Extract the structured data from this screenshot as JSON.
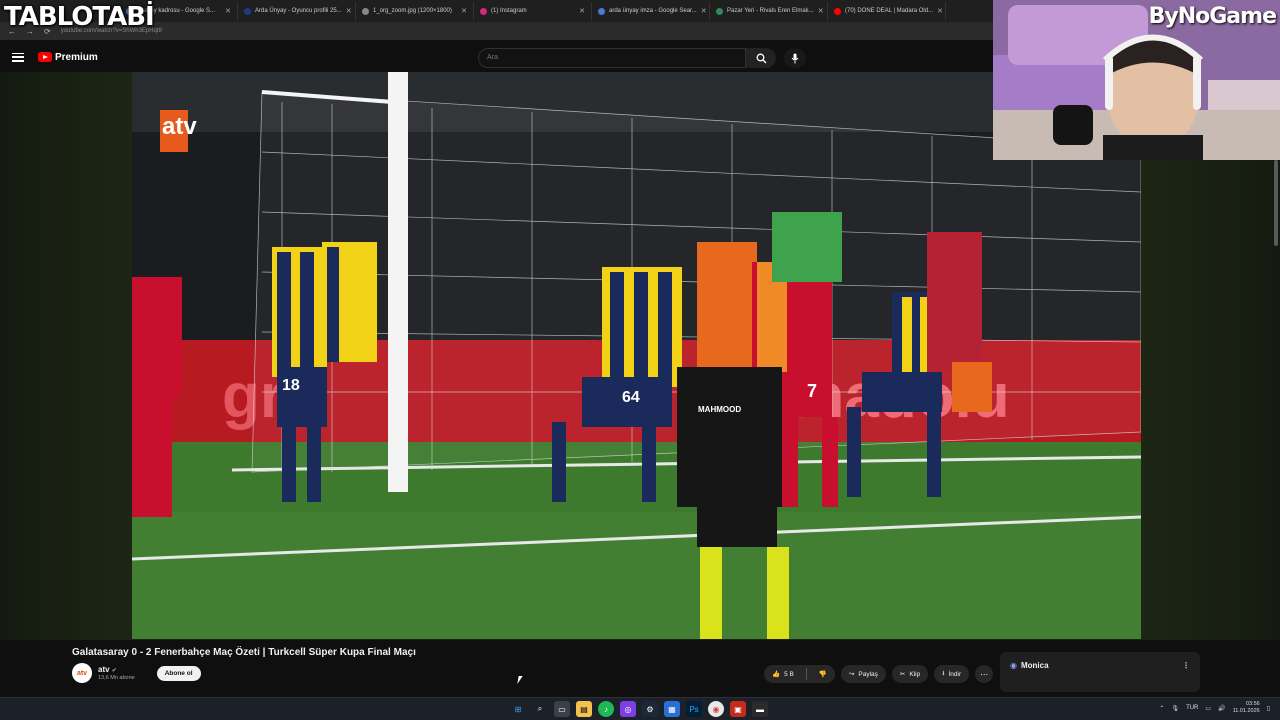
{
  "overlay": {
    "brand_left": "TABLOTABİ",
    "brand_right": "ByNoGame"
  },
  "browser": {
    "tabs": [
      {
        "label": "...saray kadrosu - Google S...",
        "icon": "google-icon"
      },
      {
        "label": "Arda Ünyay - Oyuncu profili 25...",
        "icon": "transfermarkt-icon"
      },
      {
        "label": "1_org_zoom.jpg (1200×1800)",
        "icon": "image-icon"
      },
      {
        "label": "(1) Instagram",
        "icon": "instagram-icon"
      },
      {
        "label": "arda ünyay imza - Google Sear...",
        "icon": "google-icon"
      },
      {
        "label": "Pazar Yeri - Rivals Eren Elmalı...",
        "icon": "rivals-icon"
      },
      {
        "label": "(70) DONE DEAL | Madara Old...",
        "icon": "youtube-icon"
      }
    ],
    "url": "youtube.com/watch?v=ShWh3EpHqt8"
  },
  "youtube": {
    "logo_label": "Premium",
    "search_placeholder": "Ara"
  },
  "video": {
    "title": "Galatasaray 0 - 2 Fenerbahçe Maç Özeti | Turkcell Süper Kupa Final Maçı",
    "broadcaster_logo": "atv",
    "sponsor_board": "anadolu",
    "referee_shirt": "MAHMOOD",
    "player_numbers": [
      "18",
      "64",
      "7"
    ],
    "channel": {
      "avatar_label": "atv",
      "name": "atv",
      "subscribers": "13,6 Mn abone",
      "subscribe_label": "Abone ol"
    },
    "actions": {
      "likes": "5 B",
      "share": "Paylaş",
      "clip": "Klip",
      "download": "İndir"
    }
  },
  "sidebar_panel": {
    "label": "Monica"
  },
  "taskbar": {
    "lang": "TUR",
    "time": "03:56",
    "date": "11.01.2026"
  },
  "colors": {
    "yt_red": "#ff0000",
    "gs_red": "#c8102e",
    "fb_navy": "#1a2a5a",
    "fb_yellow": "#f2d216",
    "pitch": "#3d7a2e"
  }
}
